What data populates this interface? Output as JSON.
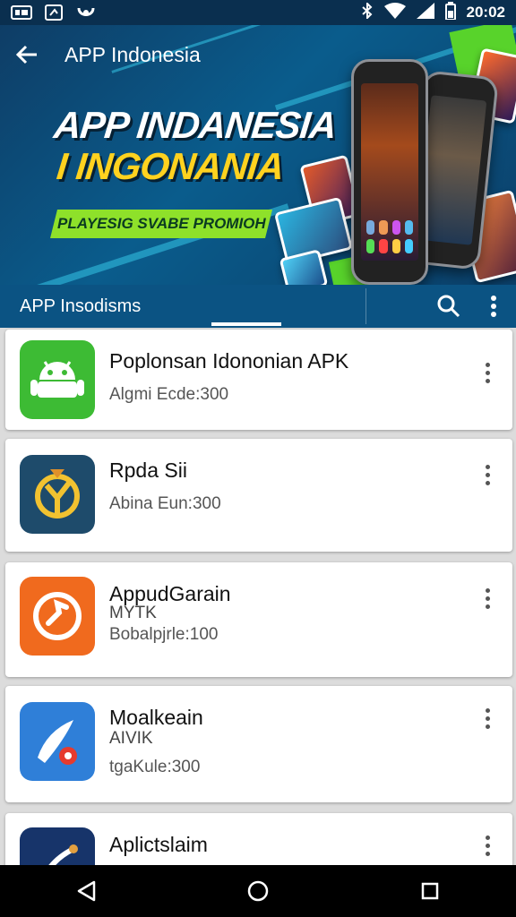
{
  "status_bar": {
    "time": "20:02",
    "left_icons": [
      "gallery-icon",
      "screenshot-icon",
      "notification-icon"
    ],
    "right_icons": [
      "bluetooth-icon",
      "wifi-icon",
      "signal-icon",
      "battery-icon"
    ]
  },
  "appbar": {
    "title": "APP Indonesia",
    "back_icon": "arrow-left-icon"
  },
  "banner": {
    "headline_line1": "APP INDANESIA",
    "headline_line2": "I INGONANIA",
    "tagline": "PLAYESIG SVABE PROMIOH"
  },
  "toolbar2": {
    "title": "APP Insodisms",
    "search_icon": "search-icon",
    "more_icon": "more-vertical-icon"
  },
  "apps": [
    {
      "name": "Poplonsan Idononian APK",
      "sub": "",
      "meta": "Algmi Ecde:300",
      "icon": "android-icon",
      "icon_color": "#3dbb34"
    },
    {
      "name": "Rpda Sii",
      "sub": "",
      "meta": "Abina Eun:300",
      "icon": "target-logo-icon",
      "icon_color": "#1e4b6b"
    },
    {
      "name": "AppudGarain",
      "sub": "MYTK",
      "meta": "Bobalpjrle:100",
      "icon": "refresh-logo-icon",
      "icon_color": "#f06a1e"
    },
    {
      "name": "Moalkeain",
      "sub": "AIVIK",
      "meta": "tgaKule:300",
      "icon": "rocket-logo-icon",
      "icon_color": "#2f7fd8"
    },
    {
      "name": "Aplictslaim",
      "sub": "",
      "meta": "",
      "icon": "app-logo-icon",
      "icon_color": "#17346a"
    }
  ],
  "navbar": {
    "back": "nav-back-icon",
    "home": "nav-home-icon",
    "recents": "nav-recents-icon"
  },
  "colors": {
    "appbar": "#0e3d66",
    "toolbar2": "#0b5383",
    "accent_yellow": "#ffd21f",
    "accent_green": "#8ee12a"
  }
}
